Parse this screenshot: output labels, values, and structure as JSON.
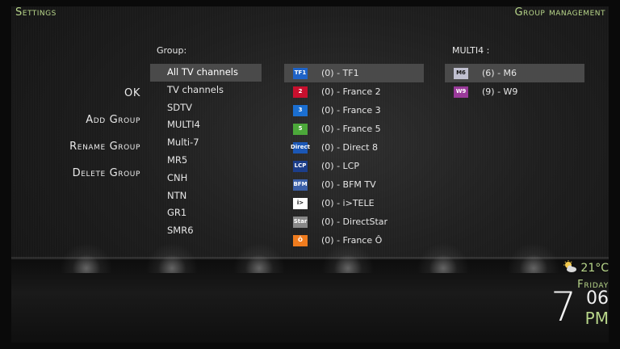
{
  "header": {
    "left_title": "Settings",
    "right_title": "Group management"
  },
  "menu": {
    "items": [
      "OK",
      "Add Group",
      "Rename Group",
      "Delete Group"
    ]
  },
  "groups": {
    "label": "Group:",
    "items": [
      "All TV channels",
      "TV channels",
      "SDTV",
      "MULTI4",
      "Multi-7",
      "MR5",
      "CNH",
      "NTN",
      "GR1",
      "SMR6"
    ],
    "selected_index": 0
  },
  "channels": {
    "items": [
      {
        "label": "(0) - TF1",
        "logo": "tf1-logo-icon",
        "logo_text": "TF1",
        "color": "#1e63c8"
      },
      {
        "label": "(0) - France 2",
        "logo": "france2-logo-icon",
        "logo_text": "2",
        "color": "#c8102e"
      },
      {
        "label": "(0) - France 3",
        "logo": "france3-logo-icon",
        "logo_text": "3",
        "color": "#1b6fd1"
      },
      {
        "label": "(0) - France 5",
        "logo": "france5-logo-icon",
        "logo_text": "5",
        "color": "#4ca83a"
      },
      {
        "label": "(0) - Direct 8",
        "logo": "direct8-logo-icon",
        "logo_text": "Direct",
        "color": "#1b57b5"
      },
      {
        "label": "(0) - LCP",
        "logo": "lcp-logo-icon",
        "logo_text": "LCP",
        "color": "#1c3e8a"
      },
      {
        "label": "(0) - BFM TV",
        "logo": "bfmtv-logo-icon",
        "logo_text": "BFM",
        "color": "#3a5fa8"
      },
      {
        "label": "(0) - i>TELE",
        "logo": "itele-logo-icon",
        "logo_text": "i>",
        "color": "#ffffff"
      },
      {
        "label": "(0) - DirectStar",
        "logo": "directstar-logo-icon",
        "logo_text": "Star",
        "color": "#888888"
      },
      {
        "label": "(0) - France Ô",
        "logo": "franceo-logo-icon",
        "logo_text": "Ô",
        "color": "#f07c1e"
      }
    ],
    "selected_index": 0
  },
  "group_content": {
    "label": "MULTI4 :",
    "items": [
      {
        "label": "(6) - M6",
        "logo": "m6-logo-icon",
        "logo_text": "M6",
        "color": "#c0c0d0"
      },
      {
        "label": "(9) - W9",
        "logo": "w9-logo-icon",
        "logo_text": "W9",
        "color": "#9a3a9a"
      }
    ],
    "selected_index": 0
  },
  "weather": {
    "temperature": "21°C",
    "icon": "partly-cloudy-icon",
    "day": "Friday"
  },
  "clock": {
    "hour": "7",
    "minute": "06",
    "ampm": "PM"
  },
  "colors": {
    "accent": "#b8d68a",
    "selection": "#4a4a4a"
  }
}
